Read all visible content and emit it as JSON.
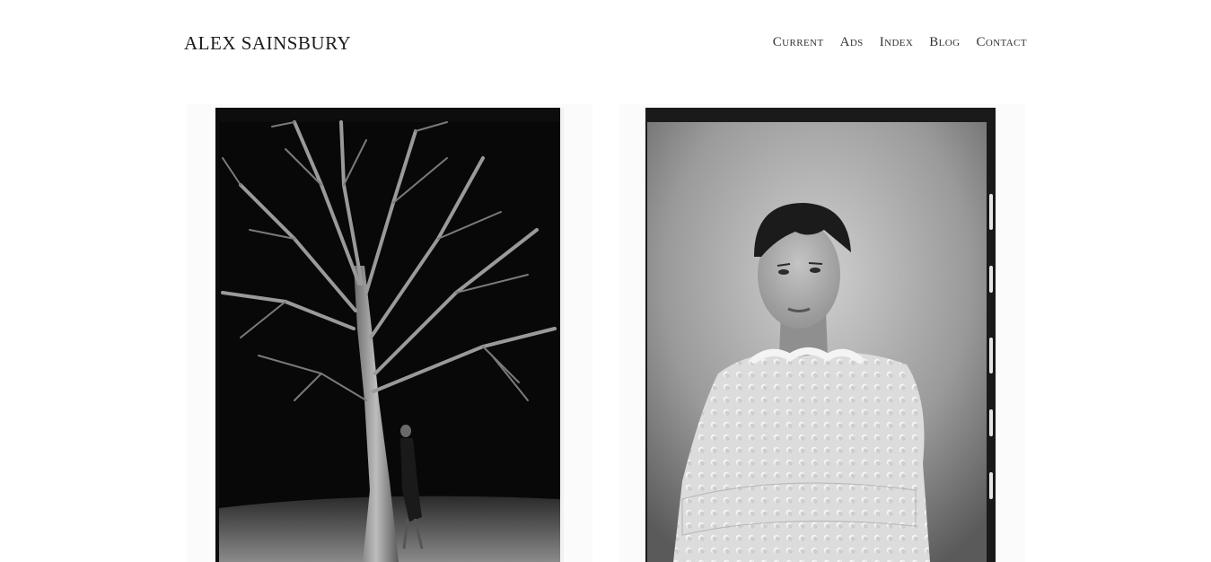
{
  "site": {
    "title": "ALEX SAINSBURY"
  },
  "nav": {
    "items": [
      {
        "label": "Current"
      },
      {
        "label": "Ads"
      },
      {
        "label": "Index"
      },
      {
        "label": "Blog"
      },
      {
        "label": "Contact"
      }
    ]
  },
  "gallery": {
    "photos": [
      {
        "alt": "Film photograph of a figure leaning against a bare tree at night"
      },
      {
        "alt": "Film portrait of a person with short dark hair in a textured white sweater"
      }
    ]
  },
  "colors": {
    "background": "#ffffff",
    "text": "#222222",
    "film_black": "#111111"
  }
}
